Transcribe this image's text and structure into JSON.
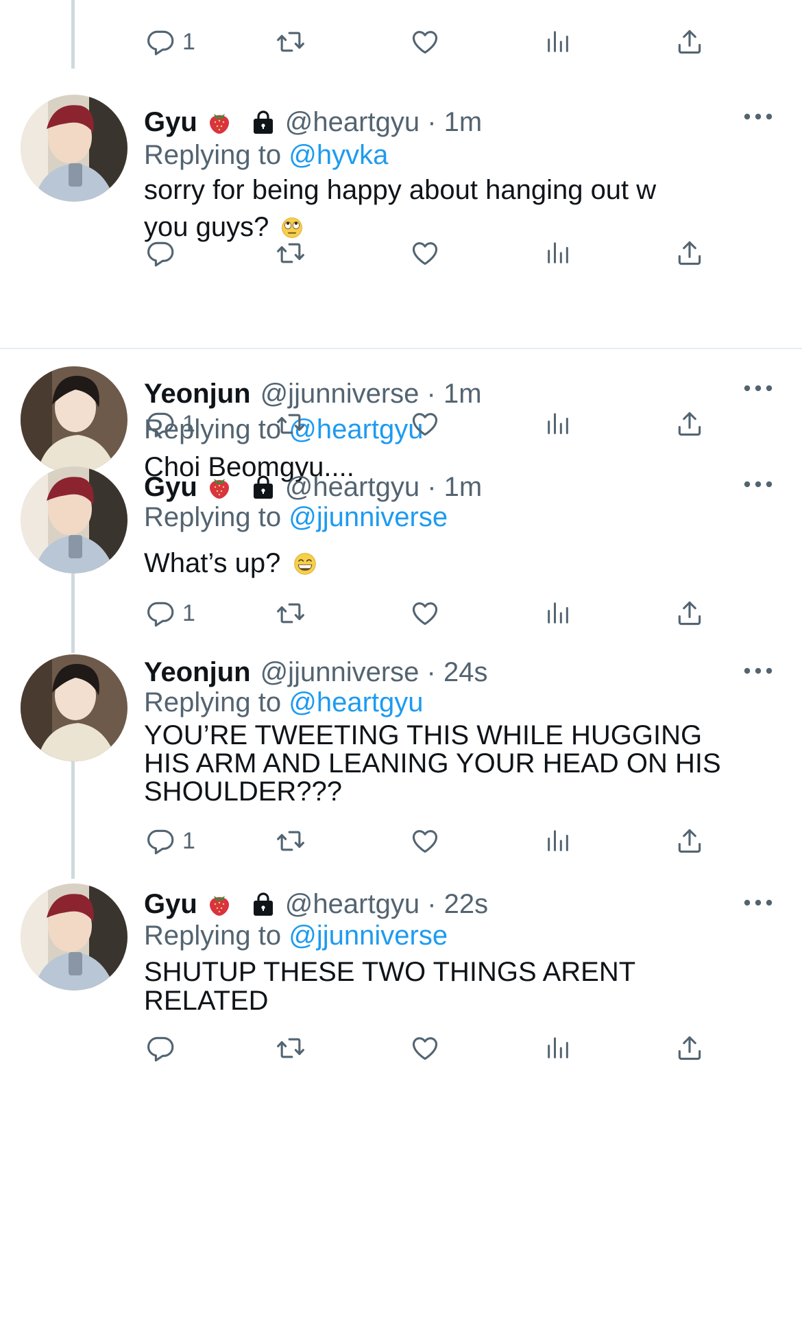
{
  "colors": {
    "text": "#0f1419",
    "secondary": "#536471",
    "link": "#1d9bf0",
    "thread_line": "#cfd9de",
    "divider": "#e6ecf0"
  },
  "replying_to_label": "Replying to",
  "top_actions": {
    "reply_count": "1"
  },
  "tweets": [
    {
      "name": "Gyu",
      "name_emoji": "strawberry",
      "protected": true,
      "handle": "@heartgyu",
      "time": "1m",
      "replying_to": "@hyvka",
      "text_lines": [
        "sorry for being happy about hanging out w",
        "you guys?"
      ],
      "text_emoji": "face-with-rolling-eyes",
      "reply_count": ""
    },
    {
      "name": "Yeonjun",
      "handle": "@jjunniverse",
      "time": "1m",
      "replying_to": "@heartgyu",
      "text": "Choi Beomgyu....",
      "reply_count": "1"
    },
    {
      "name": "Gyu",
      "name_emoji": "strawberry",
      "protected": true,
      "handle": "@heartgyu",
      "time": "1m",
      "replying_to": "@jjunniverse",
      "text": "What’s up?",
      "text_emoji": "grinning-face",
      "reply_count": "1"
    },
    {
      "name": "Yeonjun",
      "handle": "@jjunniverse",
      "time": "24s",
      "replying_to": "@heartgyu",
      "text_lines": [
        "YOU’RE TWEETING THIS WHILE HUGGING",
        "HIS ARM AND LEANING YOUR HEAD ON HIS",
        "SHOULDER???"
      ],
      "reply_count": "1"
    },
    {
      "name": "Gyu",
      "name_emoji": "strawberry",
      "protected": true,
      "handle": "@heartgyu",
      "time": "22s",
      "replying_to": "@jjunniverse",
      "text_lines": [
        "SHUTUP THESE TWO THINGS ARENT",
        "RELATED"
      ],
      "reply_count": ""
    }
  ]
}
